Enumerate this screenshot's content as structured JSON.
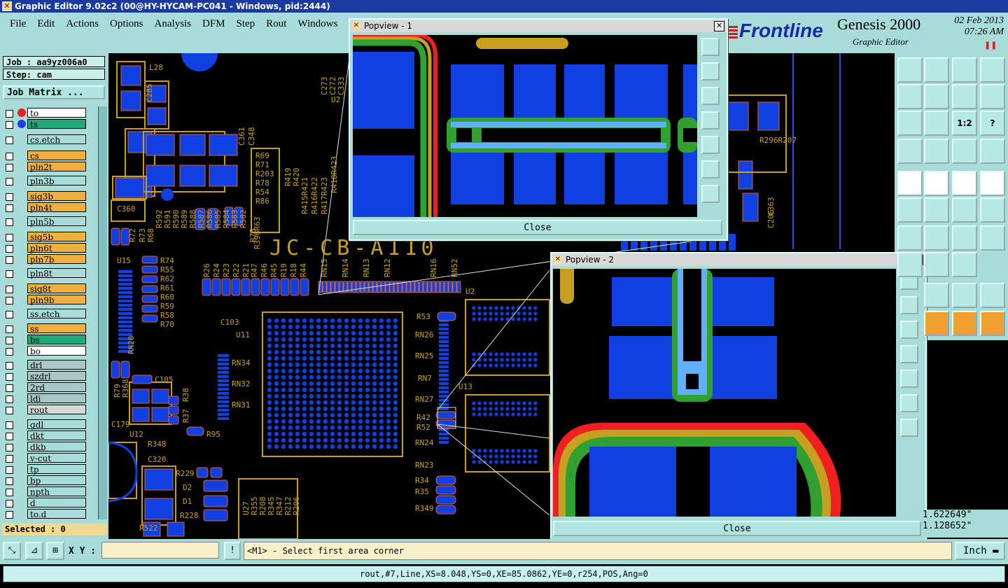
{
  "window": {
    "title": "Graphic Editor 9.02c2 (00@HY-HYCAM-PC041 - Windows, pid:2444)"
  },
  "menu": [
    "File",
    "Edit",
    "Actions",
    "Options",
    "Analysis",
    "DFM",
    "Step",
    "Rout",
    "Windows"
  ],
  "brand": {
    "logo": "Frontline",
    "product": "Genesis 2000",
    "subtitle": "Graphic Editor",
    "date": "02 Feb 2013",
    "time": "07:26 AM"
  },
  "job": {
    "job_label": "Job : aa9yz006a0",
    "step_label": "Step: cam",
    "matrix_button": "Job Matrix ..."
  },
  "layers": [
    {
      "name": "to",
      "color": "#ffffff"
    },
    {
      "name": "ts",
      "color": "#20a878"
    },
    {
      "name": "cs.etch",
      "color": "#a8dcd8"
    },
    {
      "name": "cs",
      "color": "#f0b040"
    },
    {
      "name": "pln2t",
      "color": "#f0b040"
    },
    {
      "name": "pln3b",
      "color": "#a8dcd8"
    },
    {
      "name": "sig3b",
      "color": "#f0b040"
    },
    {
      "name": "pln4t",
      "color": "#f0b040"
    },
    {
      "name": "pln5b",
      "color": "#a8dcd8"
    },
    {
      "name": "sig5b",
      "color": "#f0b040"
    },
    {
      "name": "pln6t",
      "color": "#f0b040"
    },
    {
      "name": "pln7b",
      "color": "#f0b040"
    },
    {
      "name": "pln8t",
      "color": "#a8dcd8"
    },
    {
      "name": "sig8t",
      "color": "#f0b040"
    },
    {
      "name": "pln9b",
      "color": "#f0b040"
    },
    {
      "name": "ss.etch",
      "color": "#a8dcd8"
    },
    {
      "name": "ss",
      "color": "#f0b040"
    },
    {
      "name": "bs",
      "color": "#20a878"
    },
    {
      "name": "bo",
      "color": "#ffffff"
    },
    {
      "name": "drl",
      "color": "#a8c8c8"
    },
    {
      "name": "szdrl",
      "color": "#a8c8c8"
    },
    {
      "name": "2rd",
      "color": "#a8c8c8"
    },
    {
      "name": "ldi",
      "color": "#a8c8c8"
    },
    {
      "name": "rout",
      "color": "#d8d8d8"
    },
    {
      "name": "gdl",
      "color": "#a8dcd8"
    },
    {
      "name": "dkt",
      "color": "#a8dcd8"
    },
    {
      "name": "dkb",
      "color": "#a8dcd8"
    },
    {
      "name": "v-cut",
      "color": "#a8dcd8"
    },
    {
      "name": "tp",
      "color": "#a8dcd8"
    },
    {
      "name": "bp",
      "color": "#a8dcd8"
    },
    {
      "name": "npth",
      "color": "#a8dcd8"
    },
    {
      "name": "d",
      "color": "#a8dcd8"
    },
    {
      "name": "to.d",
      "color": "#a8dcd8"
    }
  ],
  "selected": "Selected : 0",
  "popup1": {
    "title": "Popview - 1",
    "close": "Close"
  },
  "popup2": {
    "title": "Popview - 2",
    "close": "Close"
  },
  "coords": {
    "x": "1.622649\"",
    "y": "1.128652\""
  },
  "command": {
    "xy_label": "X Y :",
    "message": "<M1> - Select first area corner",
    "units": "Inch"
  },
  "status": "rout,#7,Line,XS=8.048,YS=0,XE=85.0862,YE=0,r254,POS,Ang=0",
  "toolbar_labels": {
    "ratio": "1:2",
    "help": "?"
  },
  "pcb": {
    "board_text": "JC-CB-A110",
    "refdes": [
      "L28",
      "C285",
      "C273",
      "C272",
      "C333",
      "U2",
      "C361",
      "C348",
      "R69",
      "R71",
      "R203",
      "R78",
      "R54",
      "R86",
      "R419",
      "R420",
      "R415R421",
      "R416R422",
      "R417R423",
      "R418R423",
      "C360",
      "R72",
      "R73",
      "R68",
      "R592",
      "R591",
      "R590",
      "R589",
      "R588",
      "R587",
      "R586",
      "R585",
      "R584",
      "R583",
      "R582",
      "R75",
      "R396R63",
      "U15",
      "R74",
      "R55",
      "R62",
      "R61",
      "R60",
      "R59",
      "R58",
      "R70",
      "R26",
      "R24",
      "R23",
      "R22",
      "R21",
      "R47",
      "R46",
      "R45",
      "R19",
      "R18",
      "R44",
      "RN15",
      "RN14",
      "RN13",
      "RN12",
      "RN16",
      "RN52",
      "C103",
      "U11",
      "U2",
      "RN34",
      "RN32",
      "RN31",
      "R53",
      "RN26",
      "RN25",
      "RN7",
      "RN27",
      "U13",
      "R42",
      "R52",
      "RN24",
      "RN23",
      "R34",
      "R35",
      "R349",
      "RN20",
      "C105",
      "R79",
      "R368",
      "R37",
      "R38",
      "U12",
      "R348",
      "R95",
      "C320",
      "R229",
      "D2",
      "D1",
      "R228",
      "R522",
      "U27",
      "R355",
      "R208",
      "R345",
      "R347",
      "R212",
      "R206",
      "R296R207",
      "C363",
      "C206",
      "C179",
      "32"
    ]
  }
}
